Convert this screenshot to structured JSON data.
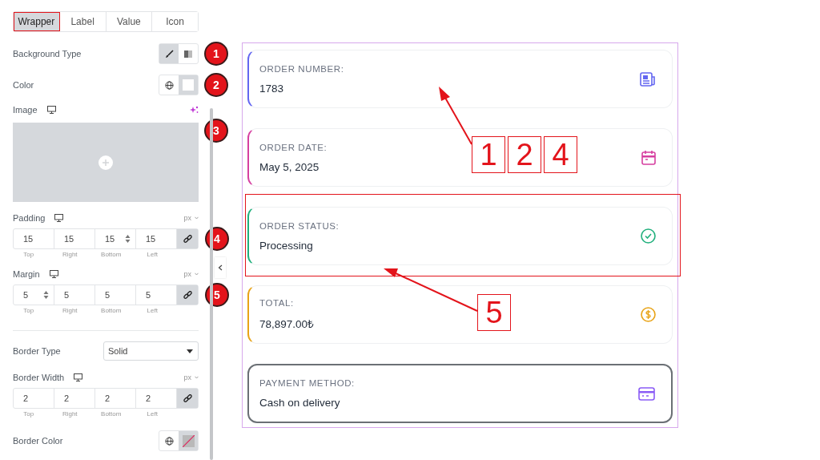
{
  "tabs": [
    {
      "label": "Wrapper",
      "selected": true
    },
    {
      "label": "Label",
      "selected": false
    },
    {
      "label": "Value",
      "selected": false
    },
    {
      "label": "Icon",
      "selected": false
    }
  ],
  "settings": [
    {
      "kind": "choice",
      "label": "Background Type",
      "options": [
        {
          "selected": true
        },
        {
          "selected": false
        }
      ],
      "badge": "1"
    },
    {
      "kind": "color",
      "label": "Color",
      "empty": false,
      "badge": "2"
    },
    {
      "kind": "image",
      "label": "Image",
      "badge": "3"
    },
    {
      "kind": "dimensions",
      "label": "Padding",
      "unit": "px",
      "linked": true,
      "values": [
        {
          "value": "15",
          "caption": "Top",
          "hover": false
        },
        {
          "value": "15",
          "caption": "Right",
          "hover": false
        },
        {
          "value": "15",
          "caption": "Bottom",
          "hover": true
        },
        {
          "value": "15",
          "caption": "Left",
          "hover": false
        }
      ],
      "badge": "4"
    },
    {
      "kind": "dimensions",
      "label": "Margin",
      "unit": "px",
      "linked": true,
      "values": [
        {
          "value": "5",
          "caption": "Top",
          "hover": true
        },
        {
          "value": "5",
          "caption": "Right",
          "hover": false
        },
        {
          "value": "5",
          "caption": "Bottom",
          "hover": false
        },
        {
          "value": "5",
          "caption": "Left",
          "hover": false
        }
      ],
      "badge": "5"
    },
    {
      "kind": "divider"
    },
    {
      "kind": "select",
      "label": "Border Type",
      "value": "Solid"
    },
    {
      "kind": "dimensions",
      "label": "Border Width",
      "unit": "px",
      "linked": true,
      "values": [
        {
          "value": "2",
          "caption": "Top",
          "hover": false
        },
        {
          "value": "2",
          "caption": "Right",
          "hover": false
        },
        {
          "value": "2",
          "caption": "Bottom",
          "hover": false
        },
        {
          "value": "2",
          "caption": "Left",
          "hover": false
        }
      ]
    },
    {
      "kind": "color",
      "label": "Border Color",
      "empty": true
    }
  ],
  "cards": [
    {
      "kind": "accent",
      "label": "ORDER NUMBER:",
      "value": "1783",
      "color": "#6366f1"
    },
    {
      "kind": "accent",
      "label": "ORDER DATE:",
      "value": "May 5, 2025",
      "color": "#d63fa0"
    },
    {
      "kind": "accent",
      "label": "ORDER STATUS:",
      "value": "Processing",
      "color": "#22b07d"
    },
    {
      "kind": "accent",
      "label": "TOTAL:",
      "value": "78,897.00₺",
      "color": "#e8a317"
    },
    {
      "kind": "bordered",
      "label": "PAYMENT METHOD:",
      "value": "Cash on delivery",
      "color": "#8b5cf6"
    }
  ],
  "callouts": [
    {
      "numbers": [
        "1",
        "2",
        "4"
      ]
    },
    {
      "numbers": [
        "5"
      ]
    }
  ]
}
